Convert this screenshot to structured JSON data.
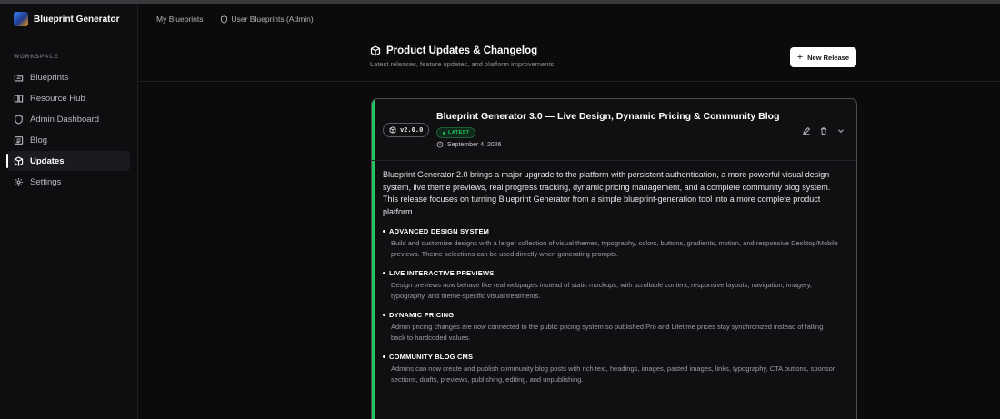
{
  "app": {
    "name": "Blueprint Generator"
  },
  "topnav": {
    "links": [
      "My Blueprints",
      "User Blueprints (Admin)"
    ]
  },
  "sidebar": {
    "section_label": "WORKSPACE",
    "items": [
      {
        "label": "Blueprints",
        "icon": "folder-icon"
      },
      {
        "label": "Resource Hub",
        "icon": "book-icon"
      },
      {
        "label": "Admin Dashboard",
        "icon": "shield-icon"
      },
      {
        "label": "Blog",
        "icon": "newspaper-icon"
      },
      {
        "label": "Updates",
        "icon": "package-icon",
        "active": true
      },
      {
        "label": "Settings",
        "icon": "gear-icon"
      }
    ]
  },
  "header": {
    "title": "Product Updates & Changelog",
    "subtitle": "Latest releases, feature updates, and platform improvements",
    "new_release_label": "New Release"
  },
  "release": {
    "version": "v2.0.0",
    "title": "Blueprint Generator 3.0 — Live Design, Dynamic Pricing & Community Blog",
    "badge": "LATEST",
    "date": "September 4, 2026",
    "summary": "Blueprint Generator 2.0 brings a major upgrade to the platform with persistent authentication, a more powerful visual design system, live theme previews, real progress tracking, dynamic pricing management, and a complete community blog system. This release focuses on turning Blueprint Generator from a simple blueprint-generation tool into a more complete product platform.",
    "features": [
      {
        "title": "ADVANCED DESIGN SYSTEM",
        "desc": "Build and customize designs with a larger collection of visual themes, typography, colors, buttons, gradients, motion, and responsive Desktop/Mobile previews. Theme selections can be used directly when generating prompts."
      },
      {
        "title": "LIVE INTERACTIVE PREVIEWS",
        "desc": "Design previews now behave like real webpages instead of static mockups, with scrollable content, responsive layouts, navigation, imagery, typography, and theme-specific visual treatments."
      },
      {
        "title": "DYNAMIC PRICING",
        "desc": "Admin pricing changes are now connected to the public pricing system so published Pro and Lifetime prices stay synchronized instead of falling back to hardcoded values."
      },
      {
        "title": "COMMUNITY BLOG CMS",
        "desc": "Admins can now create and publish community blog posts with rich text, headings, images, pasted images, links, typography, CTA buttons, sponsor sections, drafts, previews, publishing, editing, and unpublishing."
      }
    ]
  },
  "colors": {
    "accent_green": "#22c55e",
    "background": "#0b0b0c"
  }
}
